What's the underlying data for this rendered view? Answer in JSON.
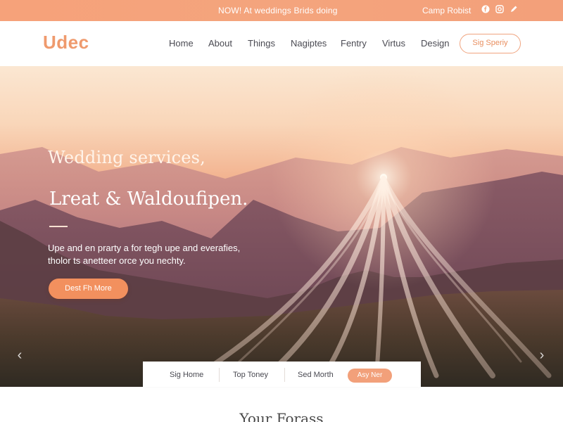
{
  "topbar": {
    "announcement": "NOW! At weddings Brids doing",
    "contact": "Camp Robist",
    "social_icons": [
      "facebook-icon",
      "instagram-icon",
      "pen-icon"
    ]
  },
  "nav": {
    "logo": "Udec",
    "items": [
      {
        "label": "Home"
      },
      {
        "label": "About"
      },
      {
        "label": "Things"
      },
      {
        "label": "Nagiptes"
      },
      {
        "label": "Fentry"
      },
      {
        "label": "Virtus"
      },
      {
        "label": "Design"
      }
    ],
    "cta": "Sig Speriy"
  },
  "hero": {
    "title_line1": "Wedding services,",
    "title_line2": "Lreat & Waldoufipen.",
    "description": "Upe and en prarty a for tegh upe and everafies, tholor ts anetteer orce you nechty.",
    "cta": "Dest Fh More"
  },
  "carousel": {
    "prev": "‹",
    "next": "›"
  },
  "booking": {
    "field1": "Sig Home",
    "field2": "Top Toney",
    "field3": "Sed Morth",
    "button": "Asy Ner"
  },
  "section": {
    "title": "Your Forass"
  },
  "colors": {
    "accent": "#f2905e",
    "topbar": "#f6a27a",
    "logo": "#ef9a6d"
  }
}
